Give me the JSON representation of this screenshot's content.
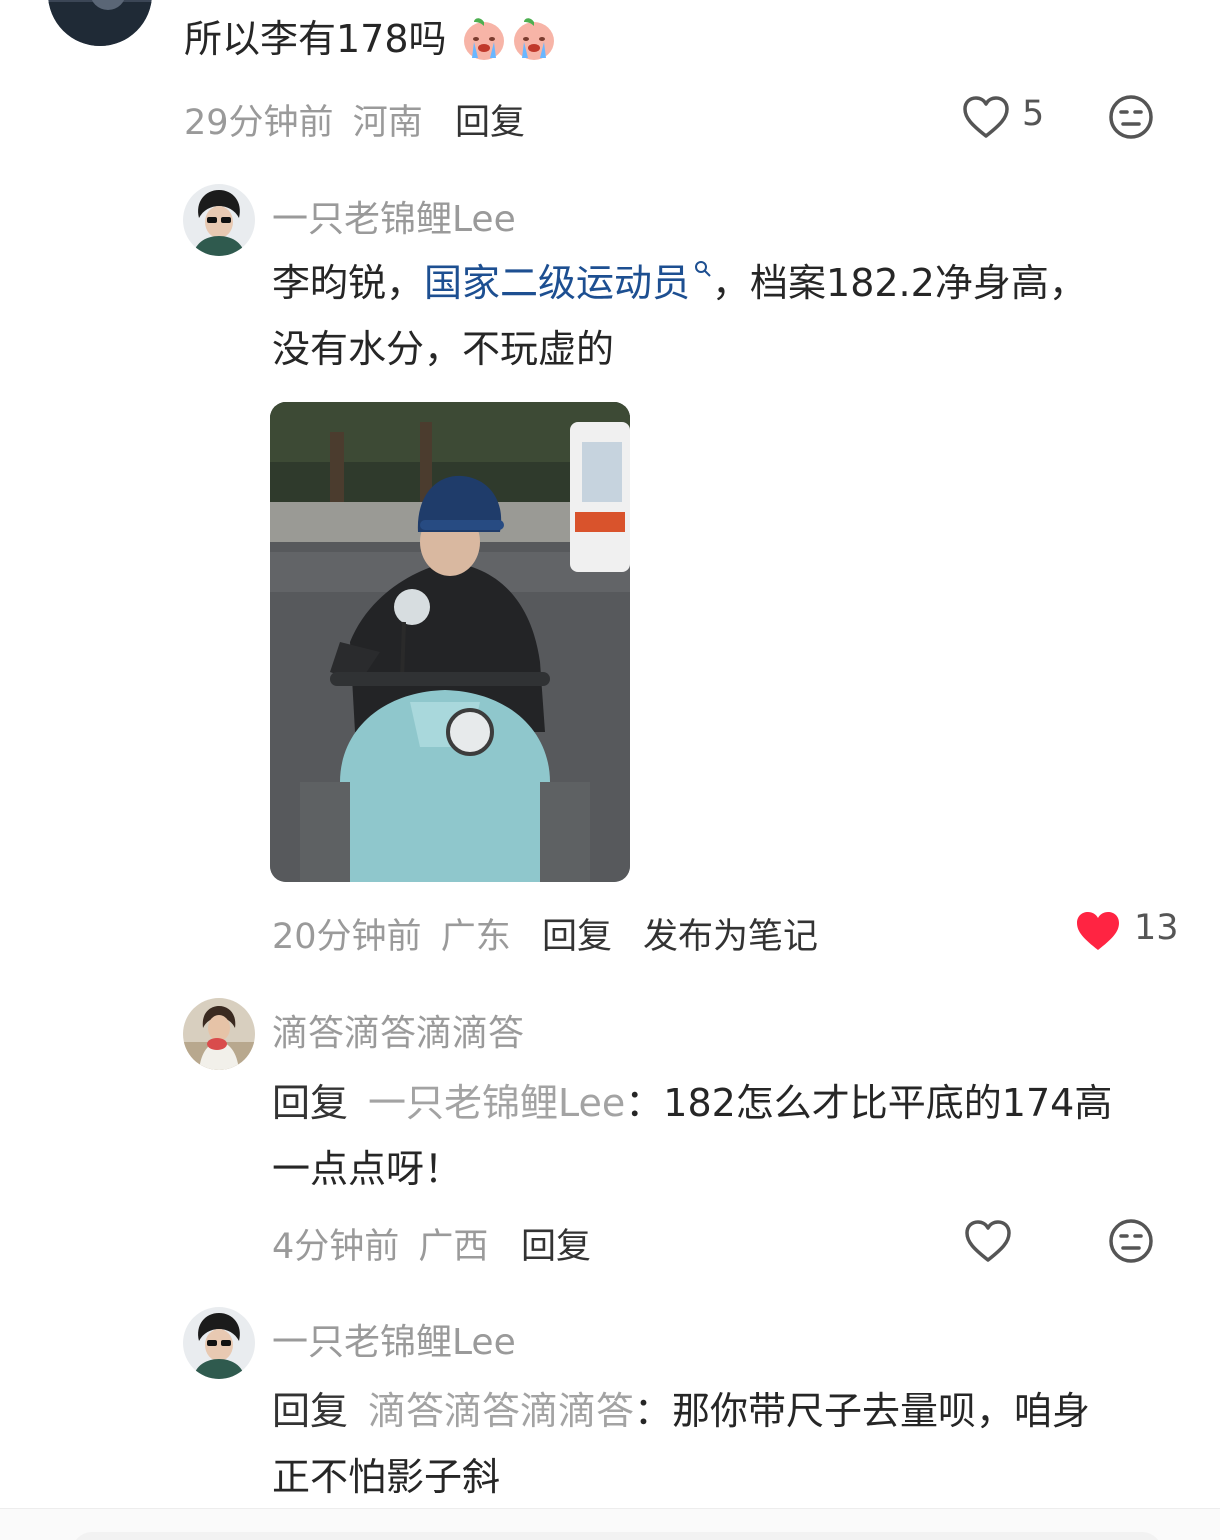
{
  "top_comment": {
    "text": "所以李有178吗",
    "emoji_icon": "crying-peach-emoji",
    "time": "29分钟前",
    "location": "河南",
    "reply_label": "回复",
    "like_count": "5"
  },
  "reply1": {
    "username": "一只老锦鲤Lee",
    "text_part1": "李昀锐，",
    "link_text": "国家二级运动员",
    "text_part2": "，档案182.2净身高，",
    "text_line2": "没有水分，不玩虚的",
    "time": "20分钟前",
    "location": "广东",
    "reply_label": "回复",
    "publish_label": "发布为笔记",
    "like_count": "13",
    "liked_color": "#ff2442"
  },
  "reply2": {
    "username": "滴答滴答滴滴答",
    "reply_prefix": "回复",
    "reply_to": "一只老锦鲤Lee",
    "text_part1": "：182怎么才比平底的174高",
    "text_line2": "一点点呀！",
    "time": "4分钟前",
    "location": "广西",
    "reply_label": "回复"
  },
  "reply3": {
    "username": "一只老锦鲤Lee",
    "reply_prefix": "回复",
    "reply_to": "滴答滴答滴滴答",
    "text_part1": "：那你带尺子去量呗，咱身",
    "text_line2": "正不怕影子斜"
  }
}
